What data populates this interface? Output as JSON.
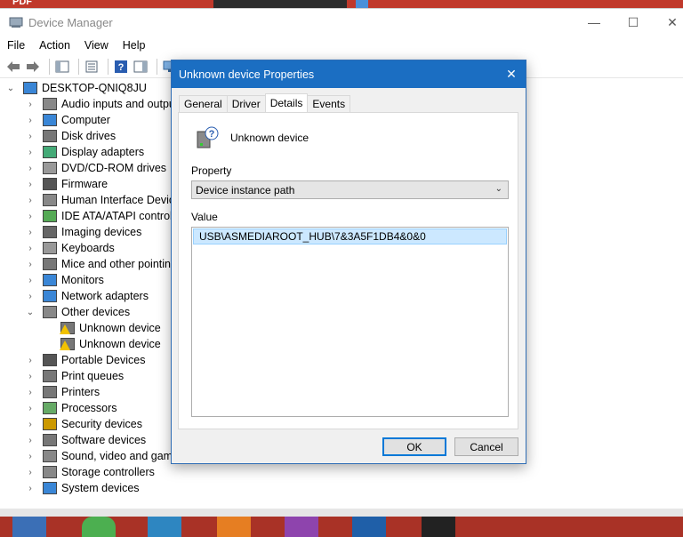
{
  "desktop": {
    "top_label": "PDF"
  },
  "window": {
    "title": "Device Manager",
    "menu": [
      "File",
      "Action",
      "View",
      "Help"
    ],
    "tree": {
      "root": "DESKTOP-QNIQ8JU",
      "items": [
        {
          "label": "Audio inputs and outpu",
          "icon": "speaker-icon",
          "expanded": false
        },
        {
          "label": "Computer",
          "icon": "computer-icon",
          "expanded": false
        },
        {
          "label": "Disk drives",
          "icon": "disk-drive-icon",
          "expanded": false
        },
        {
          "label": "Display adapters",
          "icon": "display-adapter-icon",
          "expanded": false
        },
        {
          "label": "DVD/CD-ROM drives",
          "icon": "dvd-drive-icon",
          "expanded": false
        },
        {
          "label": "Firmware",
          "icon": "firmware-icon",
          "expanded": false
        },
        {
          "label": "Human Interface Device",
          "icon": "hid-icon",
          "expanded": false
        },
        {
          "label": "IDE ATA/ATAPI controlle",
          "icon": "ide-controller-icon",
          "expanded": false
        },
        {
          "label": "Imaging devices",
          "icon": "camera-icon",
          "expanded": false
        },
        {
          "label": "Keyboards",
          "icon": "keyboard-icon",
          "expanded": false
        },
        {
          "label": "Mice and other pointing",
          "icon": "mouse-icon",
          "expanded": false
        },
        {
          "label": "Monitors",
          "icon": "monitor-icon",
          "expanded": false
        },
        {
          "label": "Network adapters",
          "icon": "network-adapter-icon",
          "expanded": false
        },
        {
          "label": "Other devices",
          "icon": "unknown-device-icon",
          "expanded": true,
          "children": [
            "Unknown device",
            "Unknown device"
          ]
        },
        {
          "label": "Portable Devices",
          "icon": "portable-device-icon",
          "expanded": false
        },
        {
          "label": "Print queues",
          "icon": "printer-icon",
          "expanded": false
        },
        {
          "label": "Printers",
          "icon": "printer-icon",
          "expanded": false
        },
        {
          "label": "Processors",
          "icon": "processor-icon",
          "expanded": false
        },
        {
          "label": "Security devices",
          "icon": "security-device-icon",
          "expanded": false
        },
        {
          "label": "Software devices",
          "icon": "software-device-icon",
          "expanded": false
        },
        {
          "label": "Sound, video and game",
          "icon": "speaker-icon",
          "expanded": false
        },
        {
          "label": "Storage controllers",
          "icon": "storage-controller-icon",
          "expanded": false
        },
        {
          "label": "System devices",
          "icon": "system-device-icon",
          "expanded": false
        }
      ]
    }
  },
  "dialog": {
    "title": "Unknown device Properties",
    "tabs": [
      "General",
      "Driver",
      "Details",
      "Events"
    ],
    "active_tab": "Details",
    "device_name": "Unknown device",
    "property_label": "Property",
    "property_value": "Device instance path",
    "value_label": "Value",
    "value": "USB\\ASMEDIAROOT_HUB\\7&3A5F1DB4&0&0",
    "ok_label": "OK",
    "cancel_label": "Cancel"
  },
  "colors": {
    "dialog_title_bg": "#1b6ec2",
    "selection_bg": "#cce8ff",
    "ok_border": "#0078d7"
  }
}
